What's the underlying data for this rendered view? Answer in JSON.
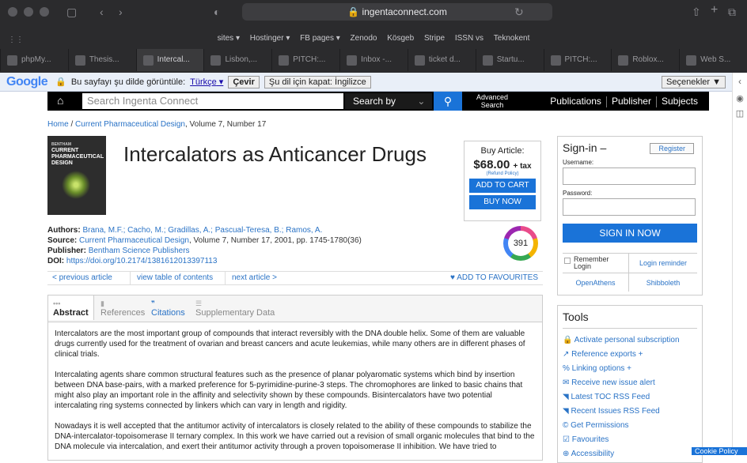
{
  "browser": {
    "url": "ingentaconnect.com",
    "favorites": [
      "sites ▾",
      "Hostinger ▾",
      "FB pages ▾",
      "Zenodo",
      "Kösgeb",
      "Stripe",
      "ISSN vs",
      "Teknokent"
    ],
    "tabs": [
      "phpMy...",
      "Thesis...",
      "Intercal...",
      "Lisbon,...",
      "PITCH:...",
      "Inbox -...",
      "ticket d...",
      "Startu...",
      "PITCH:...",
      "Roblox...",
      "Web S..."
    ]
  },
  "translate_bar": {
    "logo": "Google",
    "prompt": "Bu sayfayı şu dilde görüntüle:",
    "language": "Türkçe",
    "translate_btn": "Çevir",
    "never_btn": "Şu dil için kapat: İngilizce",
    "options_btn": "Seçenekler ▼"
  },
  "nav": {
    "home_icon": "home-icon",
    "search_placeholder": "Search Ingenta Connect",
    "search_by": "Search by",
    "advanced": "Advanced Search",
    "links": [
      "Publications",
      "Publisher",
      "Subjects"
    ]
  },
  "breadcrumb": {
    "home": "Home",
    "journal": "Current Pharmaceutical Design",
    "issue": ", Volume 7, Number 17"
  },
  "cover": {
    "small": "BENTHAM",
    "line1": "CURRENT",
    "line2": "PHARMACEUTICAL",
    "line3": "DESIGN"
  },
  "article": {
    "title": "Intercalators as Anticancer Drugs",
    "authors_label": "Authors:",
    "authors": "Brana, M.F.; Cacho, M.; Gradillas, A.; Pascual-Teresa, B.; Ramos, A.",
    "source_label": "Source:",
    "source_journal": "Current Pharmaceutical Design",
    "source_rest": ", Volume 7, Number 17, 2001, pp. 1745-1780(36)",
    "publisher_label": "Publisher:",
    "publisher": "Bentham Science Publishers",
    "doi_label": "DOI:",
    "doi": "https://doi.org/10.2174/1381612013397113"
  },
  "buy": {
    "heading": "Buy Article:",
    "price": "$68.00",
    "tax": "+ tax",
    "refund": "(Refund Policy)",
    "cart": "ADD TO CART",
    "now": "BUY NOW"
  },
  "altmetric": "391",
  "artnav": {
    "prev": "< previous article",
    "toc": "view table of contents",
    "next": "next article >",
    "fav": "♥ ADD TO FAVOURITES"
  },
  "tabs": [
    "Abstract",
    "References",
    "Citations",
    "Supplementary Data"
  ],
  "abstract": [
    "Intercalators are the most important group of compounds that interact reversibly with the DNA double helix. Some of them are valuable drugs currently used for the treatment of ovarian and breast cancers and acute leukemias, while many others are in different phases of clinical trials.",
    "Intercalating agents share common structural features such as the presence of planar polyaromatic systems which bind by insertion between DNA base-pairs, with a marked preference for 5-pyrimidine-purine-3 steps. The chromophores are linked to basic chains that might also play an important role in the affinity and selectivity shown by these compounds. Bisintercalators have two potential intercalating ring systems connected by linkers which can vary in length and rigidity.",
    "Nowadays it is well accepted that the antitumor activity of intercalators is closely related to the ability of these compounds to stabilize the DNA-intercalator-topoisomerase II ternary complex. In this work we have carried out a revision of small organic molecules that bind to the DNA molecule via intercalation, and exert their antitumor activity through a proven topoisomerase II inhibition. We have tried to"
  ],
  "signin": {
    "heading": "Sign-in –",
    "register": "Register",
    "username": "Username:",
    "password": "Password:",
    "button": "SIGN IN NOW",
    "remember": "Remember Login",
    "reminder": "Login reminder",
    "openathens": "OpenAthens",
    "shibboleth": "Shibboleth"
  },
  "tools": {
    "heading": "Tools",
    "items": [
      "🔒 Activate personal subscription",
      "↗ Reference exports +",
      "% Linking options +",
      "✉ Receive new issue alert",
      "◥ Latest TOC RSS Feed",
      "◥ Recent Issues RSS Feed",
      "© Get Permissions",
      "☑ Favourites",
      "⊕ Accessibility"
    ]
  },
  "cookie": "Cookie Policy"
}
